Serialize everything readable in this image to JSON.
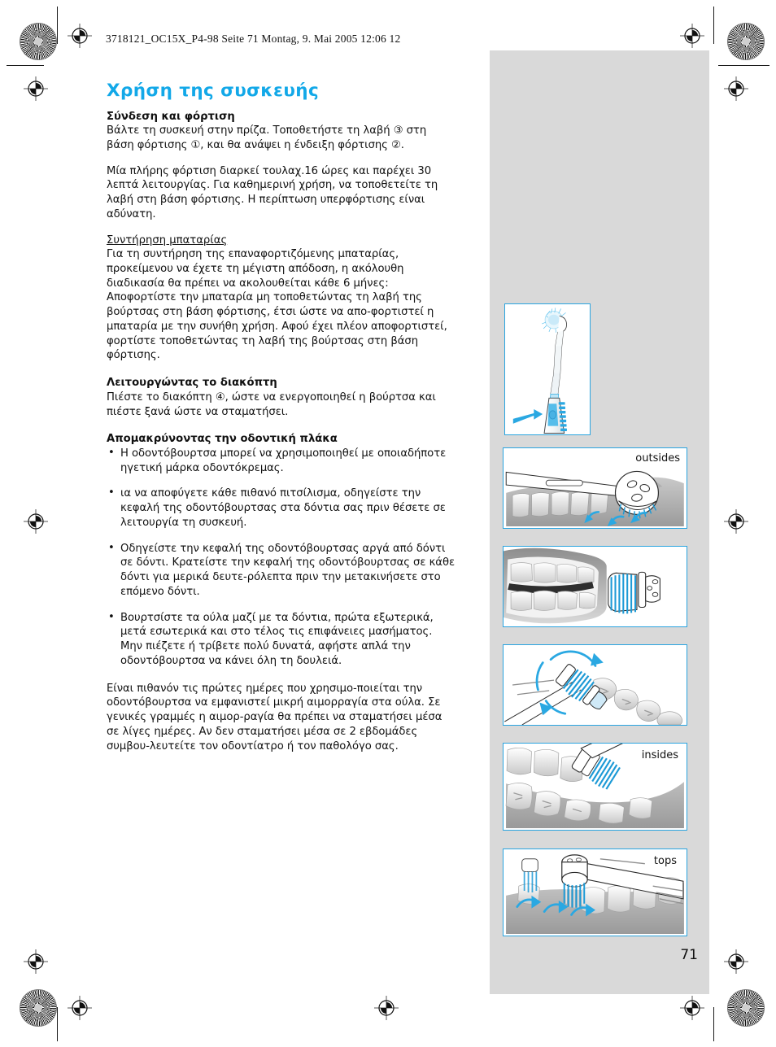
{
  "document": {
    "header_line": "3718121_OC15X_P4-98  Seite 71  Montag, 9. Mai 2005  12:06 12",
    "page_number": "71",
    "accent_color": "#12a8e8",
    "sidebar_color": "#d9d9d9"
  },
  "content": {
    "title": "Χρήση της συσκευής",
    "section_charging": {
      "heading": "Σύνδεση και φόρτιση",
      "paragraph_1": "Βάλτε τη συσκευή στην πρίζα. Τοποθετήστε τη λαβή ③ στη βάση φόρτισης ①, και θα ανάψει η ένδειξη φόρτισης ②.",
      "paragraph_2": "Μία πλήρης φόρτιση διαρκεί τουλαχ.16 ώρες και παρέχει 30 λεπτά λειτουργίας. Για καθημερινή χρήση, να τοποθετείτε τη λαβή στη βάση φόρτισης. Η περίπτωση υπερφόρτισης είναι αδύνατη."
    },
    "section_battery": {
      "heading": "Συντήρηση μπαταρίας",
      "paragraph": "Για τη συντήρηση της επαναφορτιζόμενης μπαταρίας, προκείμενου να έχετε τη μέγιστη απόδοση, η ακόλουθη διαδικασία θα πρέπει να ακολουθείται κάθε 6 μήνες: Αποφορτίστε την μπαταρία μη τοποθετώντας τη λαβή της βούρτσας στη βάση φόρτισης, έτσι ώστε να απο-φορτιστεί η μπαταρία με την συνήθη χρήση. Αφού έχει πλέον αποφορτιστεί, φορτίστε τοποθετώντας τη λαβή της βούρτσας στη βάση φόρτισης."
    },
    "section_switch": {
      "heading": "Λειτουργώντας το διακόπτη",
      "paragraph": "Πιέστε το διακόπτη ④, ώστε να ενεργοποιηθεί η βούρτσα και πιέστε ξανά ώστε να σταματήσει."
    },
    "section_plaque": {
      "heading": "Απομακρύνοντας την οδοντική πλάκα",
      "bullets": [
        "Η οδοντόβουρτσα μπορεί να χρησιμοποιηθεί με οποιαδήποτε ηγετική μάρκα οδοντόκρεμας.",
        "ια να αποφύγετε κάθε πιθανό πιτσίλισμα, οδηγείστε την κεφαλή της οδοντόβουρτσας στα δόντια σας πριν θέσετε σε λειτουργία τη συσκευή.",
        "Οδηγείστε την κεφαλή της οδοντόβουρτσας αργά από δόντι σε δόντι. Κρατείστε την κεφαλή της οδοντόβουρτσας σε κάθε δόντι για μερικά δευτε-ρόλεπτα πριν την μετακινήσετε στο επόμενο δόντι.",
        "Βουρτσίστε τα ούλα μαζί με τα δόντια, πρώτα εξωτερικά, μετά εσωτερικά και στο τέλος τις επιφάνειες μασήματος. Μην πιέζετε ή τρίβετε πολύ δυνατά, αφήστε απλά την οδοντόβουρτσα να κάνει όλη τη δουλειά."
      ]
    },
    "closing_paragraph": "Είναι πιθανόν τις πρώτες ημέρες που χρησιμο-ποιείται την οδοντόβουρτσα να εμφανιστεί μικρή αιμορραγία στα ούλα. Σε γενικές γραμμές η αιμορ-ραγία θα πρέπει να σταματήσει μέσα σε λίγες ημέρες. Αν δεν σταματήσει μέσα σε 2 εβδομάδες συμβου-λευτείτε τον οδοντίατρο ή τον παθολόγο σας."
  },
  "illustrations": [
    {
      "name": "handle-power-button",
      "label": ""
    },
    {
      "name": "brushing-outsides",
      "label": "outsides"
    },
    {
      "name": "brush-head-closed-teeth",
      "label": ""
    },
    {
      "name": "brush-head-rotation",
      "label": ""
    },
    {
      "name": "brushing-insides",
      "label": "insides"
    },
    {
      "name": "brushing-tops",
      "label": "tops"
    }
  ]
}
